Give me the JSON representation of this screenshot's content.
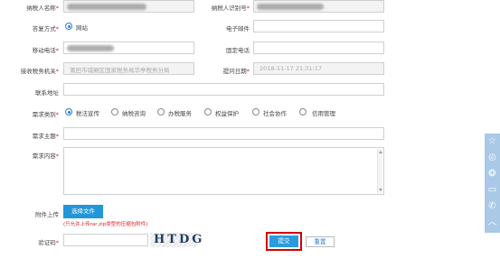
{
  "form": {
    "taxpayer_name": {
      "label": "纳税人名称",
      "required": "*"
    },
    "taxpayer_id": {
      "label": "纳税人识别号",
      "required": "*"
    },
    "reply_method": {
      "label": "答复方式",
      "required": "*",
      "option": "网站",
      "selected": true
    },
    "email": {
      "label": "电子邮件",
      "value": ""
    },
    "mobile": {
      "label": "移动电话",
      "required": "*"
    },
    "landline": {
      "label": "固定电话",
      "value": ""
    },
    "tax_office": {
      "label": "接收税务机关",
      "required": "*",
      "value": "莆田市城厢区国家税务局华亭税务分局"
    },
    "submit_date": {
      "label": "提问日期",
      "required": "*",
      "value": "2018-11-17 21:31:17"
    },
    "address": {
      "label": "联系地址",
      "value": ""
    },
    "category": {
      "label": "需求类别",
      "required": "*",
      "options": [
        {
          "label": "税法宣传",
          "selected": true
        },
        {
          "label": "纳税咨询",
          "selected": false
        },
        {
          "label": "办税服务",
          "selected": false
        },
        {
          "label": "权益保护",
          "selected": false
        },
        {
          "label": "社会协作",
          "selected": false
        },
        {
          "label": "信用管理",
          "selected": false
        }
      ]
    },
    "subject": {
      "label": "需求主题",
      "required": "*",
      "value": ""
    },
    "content": {
      "label": "需求内容",
      "required": "*",
      "value": ""
    },
    "attachment": {
      "label": "附件上传",
      "button": "选择文件",
      "hint": "(只允许上传rar,zip类型的压缩包附件)"
    },
    "captcha": {
      "label": "验证码",
      "required": "*",
      "value": "",
      "image_text": "HTDG"
    },
    "actions": {
      "submit": "提交",
      "reset": "重置"
    }
  },
  "colors": {
    "accent": "#2196d9",
    "required": "#e02020",
    "highlight": "#d40000",
    "sidebar": "#a9c9e6"
  },
  "sidebar_icons": [
    "star-icon",
    "weibo-icon",
    "wechat-icon",
    "message-icon",
    "phone-icon",
    "back-to-top-icon"
  ]
}
